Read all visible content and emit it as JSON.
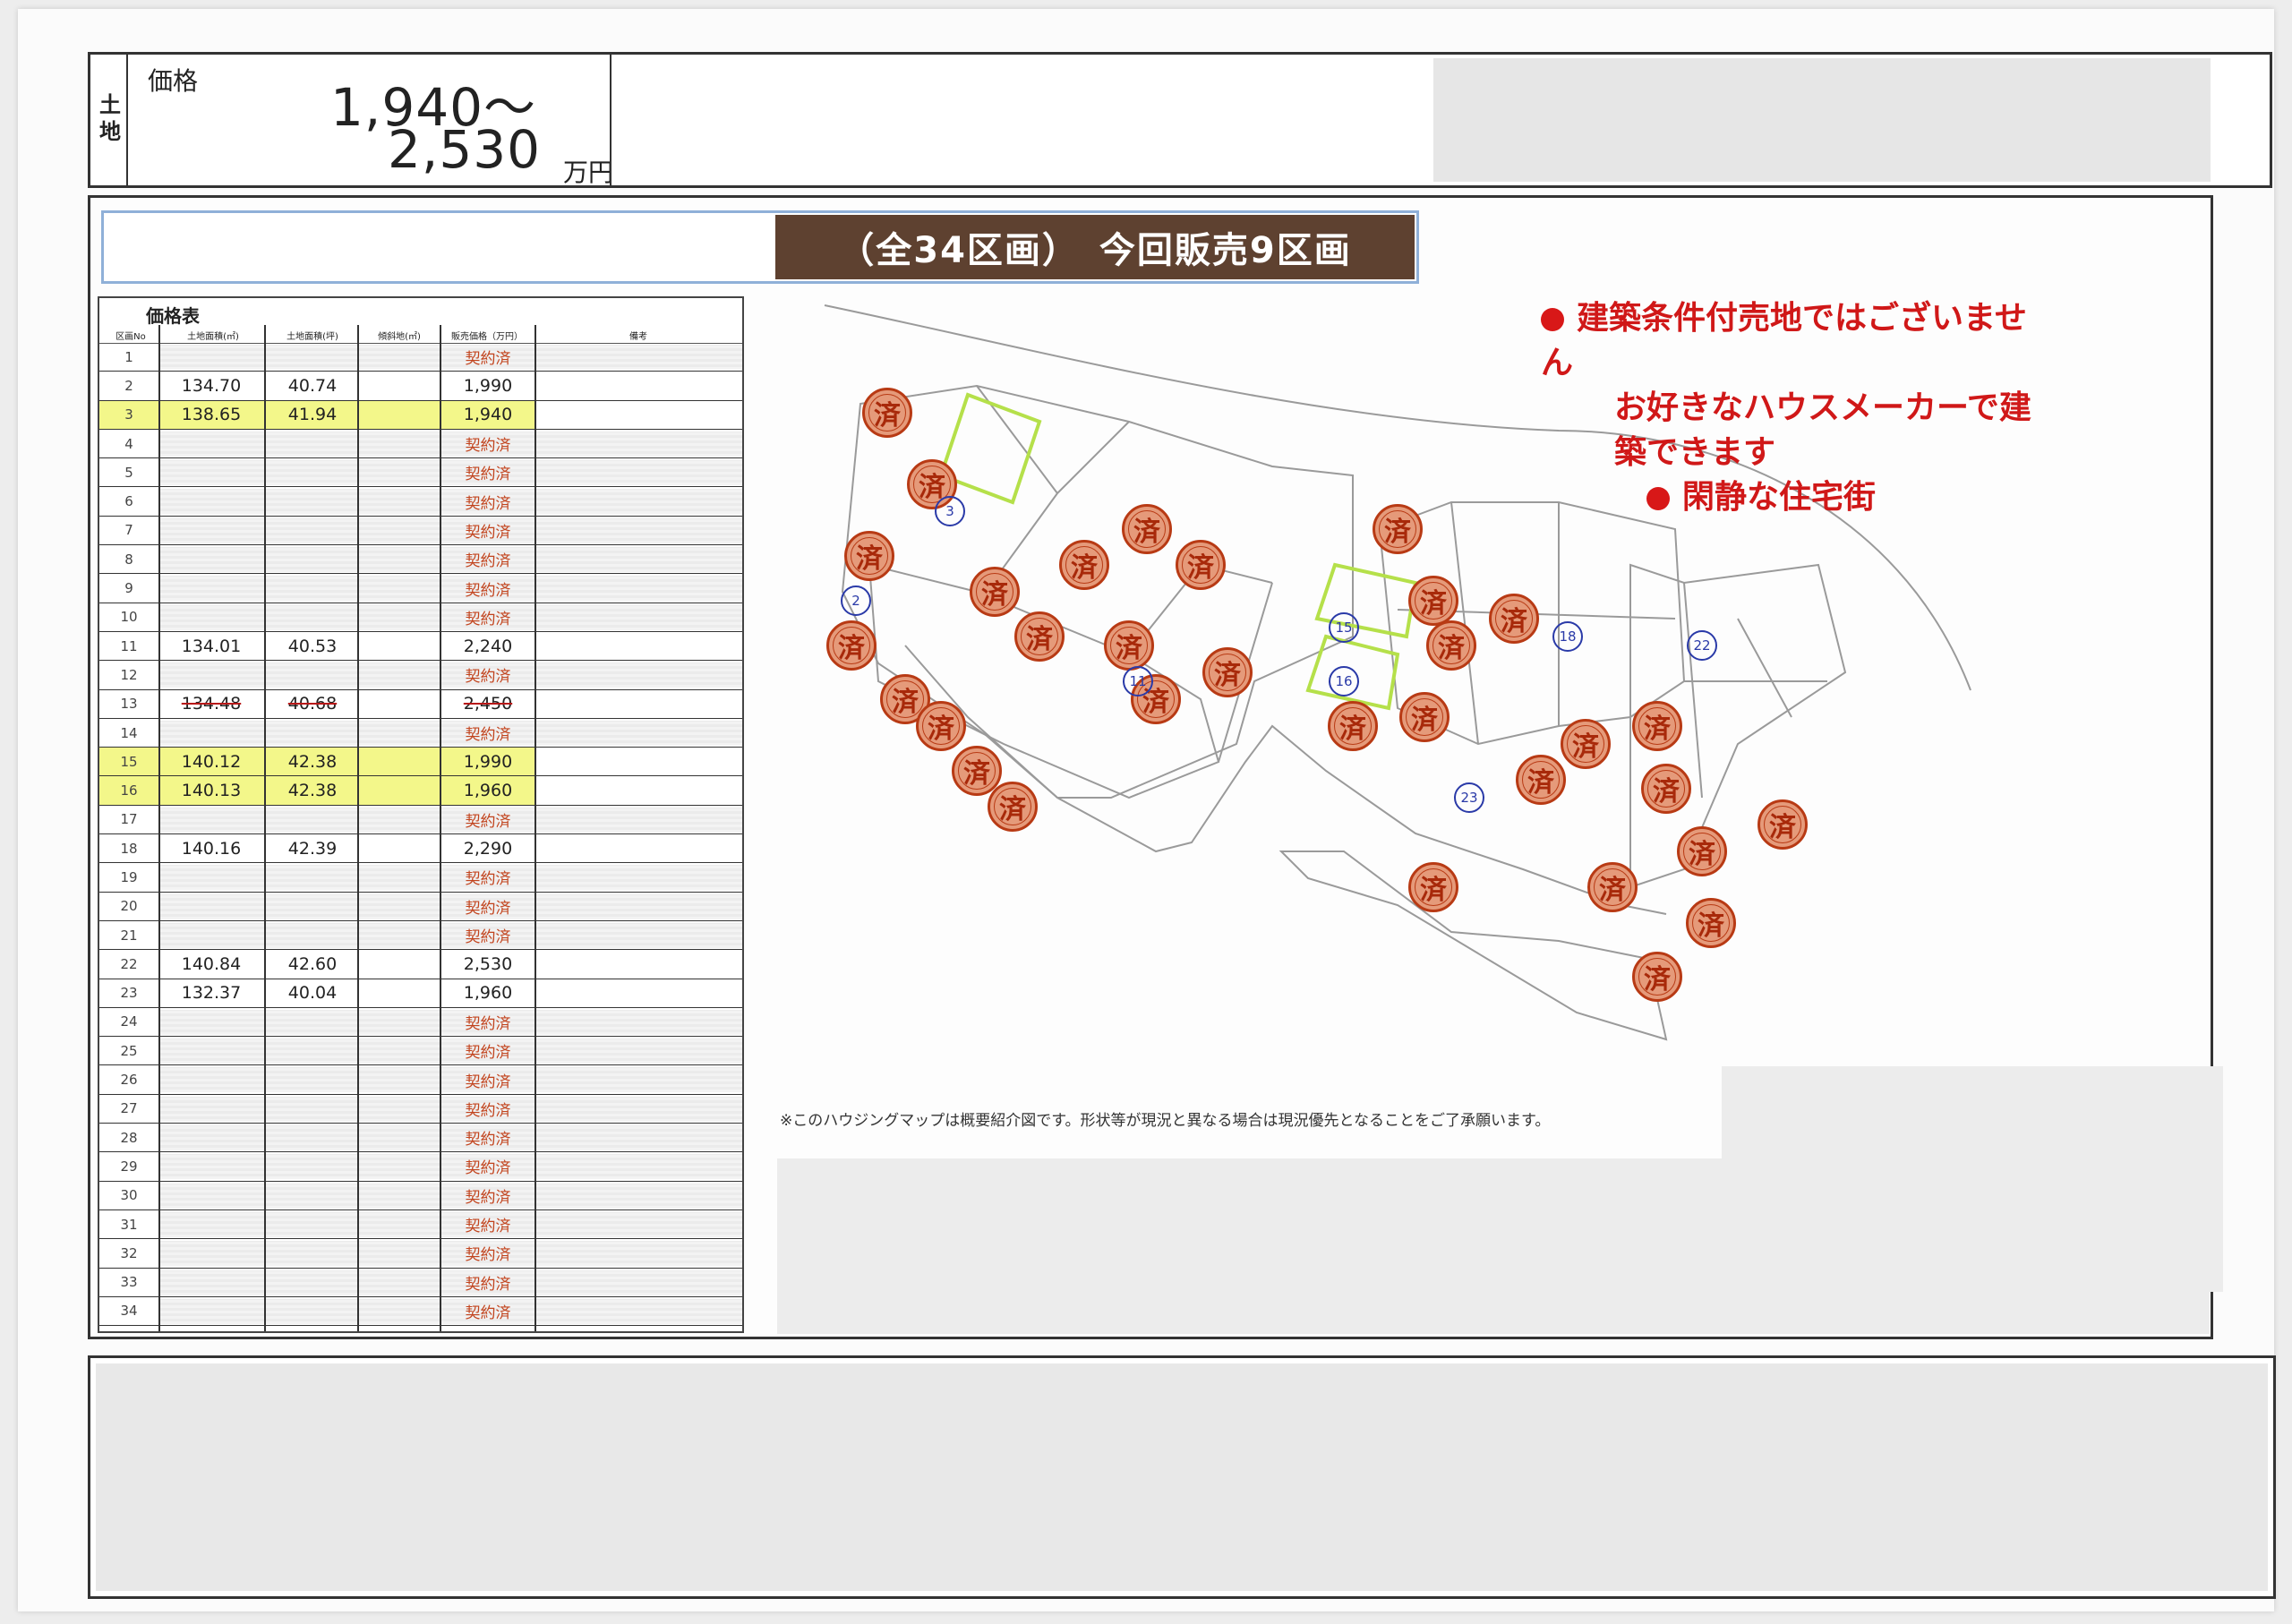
{
  "header": {
    "land_label": "土地",
    "price_label": "価格",
    "price_min": "1,940～",
    "price_max": "2,530",
    "price_unit": "万円"
  },
  "banner": {
    "text": "（全34区画）　今回販売9区画"
  },
  "price_table": {
    "title": "価格表",
    "columns": [
      "区画No",
      "土地面積(㎡)",
      "土地面積(坪)",
      "傾斜地(㎡)",
      "販売価格（万円）",
      "備考"
    ],
    "sold_label": "契約済",
    "rows": [
      {
        "no": "1",
        "a1": "",
        "a2": "",
        "price": "契約済",
        "status": "sold"
      },
      {
        "no": "2",
        "a1": "134.70",
        "a2": "40.74",
        "price": "1,990",
        "status": "available"
      },
      {
        "no": "3",
        "a1": "138.65",
        "a2": "41.94",
        "price": "1,940",
        "status": "highlight"
      },
      {
        "no": "4",
        "a1": "",
        "a2": "",
        "price": "契約済",
        "status": "sold"
      },
      {
        "no": "5",
        "a1": "",
        "a2": "",
        "price": "契約済",
        "status": "sold"
      },
      {
        "no": "6",
        "a1": "",
        "a2": "",
        "price": "契約済",
        "status": "sold"
      },
      {
        "no": "7",
        "a1": "",
        "a2": "",
        "price": "契約済",
        "status": "sold"
      },
      {
        "no": "8",
        "a1": "",
        "a2": "",
        "price": "契約済",
        "status": "sold"
      },
      {
        "no": "9",
        "a1": "",
        "a2": "",
        "price": "契約済",
        "status": "sold"
      },
      {
        "no": "10",
        "a1": "",
        "a2": "",
        "price": "契約済",
        "status": "sold"
      },
      {
        "no": "11",
        "a1": "134.01",
        "a2": "40.53",
        "price": "2,240",
        "status": "available"
      },
      {
        "no": "12",
        "a1": "",
        "a2": "",
        "price": "契約済",
        "status": "sold"
      },
      {
        "no": "13",
        "a1": "134.48",
        "a2": "40.68",
        "price": "2,450",
        "status": "struck"
      },
      {
        "no": "14",
        "a1": "",
        "a2": "",
        "price": "契約済",
        "status": "sold"
      },
      {
        "no": "15",
        "a1": "140.12",
        "a2": "42.38",
        "price": "1,990",
        "status": "highlight"
      },
      {
        "no": "16",
        "a1": "140.13",
        "a2": "42.38",
        "price": "1,960",
        "status": "highlight"
      },
      {
        "no": "17",
        "a1": "",
        "a2": "",
        "price": "契約済",
        "status": "sold"
      },
      {
        "no": "18",
        "a1": "140.16",
        "a2": "42.39",
        "price": "2,290",
        "status": "available"
      },
      {
        "no": "19",
        "a1": "",
        "a2": "",
        "price": "契約済",
        "status": "sold"
      },
      {
        "no": "20",
        "a1": "",
        "a2": "",
        "price": "契約済",
        "status": "sold"
      },
      {
        "no": "21",
        "a1": "",
        "a2": "",
        "price": "契約済",
        "status": "sold"
      },
      {
        "no": "22",
        "a1": "140.84",
        "a2": "42.60",
        "price": "2,530",
        "status": "available"
      },
      {
        "no": "23",
        "a1": "132.37",
        "a2": "40.04",
        "price": "1,960",
        "status": "available"
      },
      {
        "no": "24",
        "a1": "",
        "a2": "",
        "price": "契約済",
        "status": "sold"
      },
      {
        "no": "25",
        "a1": "",
        "a2": "",
        "price": "契約済",
        "status": "sold"
      },
      {
        "no": "26",
        "a1": "",
        "a2": "",
        "price": "契約済",
        "status": "sold"
      },
      {
        "no": "27",
        "a1": "",
        "a2": "",
        "price": "契約済",
        "status": "sold"
      },
      {
        "no": "28",
        "a1": "",
        "a2": "",
        "price": "契約済",
        "status": "sold"
      },
      {
        "no": "29",
        "a1": "",
        "a2": "",
        "price": "契約済",
        "status": "sold"
      },
      {
        "no": "30",
        "a1": "",
        "a2": "",
        "price": "契約済",
        "status": "sold"
      },
      {
        "no": "31",
        "a1": "",
        "a2": "",
        "price": "契約済",
        "status": "sold"
      },
      {
        "no": "32",
        "a1": "",
        "a2": "",
        "price": "契約済",
        "status": "sold"
      },
      {
        "no": "33",
        "a1": "",
        "a2": "",
        "price": "契約済",
        "status": "sold"
      },
      {
        "no": "34",
        "a1": "",
        "a2": "",
        "price": "契約済",
        "status": "sold"
      }
    ]
  },
  "map": {
    "features": [
      "建築条件付売地ではございません",
      "お好きなハウスメーカーで建築できます",
      "閑静な住宅街"
    ],
    "sold_mark": "済",
    "available_lots": [
      "2",
      "3",
      "11",
      "15",
      "16",
      "18",
      "22",
      "23"
    ],
    "lot_labels": [
      "2区画",
      "3区画",
      "11区画",
      "15区画",
      "16区画",
      "18区画",
      "22区画",
      "23区画"
    ],
    "note": "※このハウジングマップは概要紹介図です。形状等が現況と異なる場合は現況優先となることをご了承願います。"
  },
  "colors": {
    "banner_bg": "#5e4130",
    "sold_red": "#b83a14",
    "feature_red": "#d01818",
    "highlight_yellow": "#f3f78a",
    "lot_blue": "#2a3aa8"
  }
}
